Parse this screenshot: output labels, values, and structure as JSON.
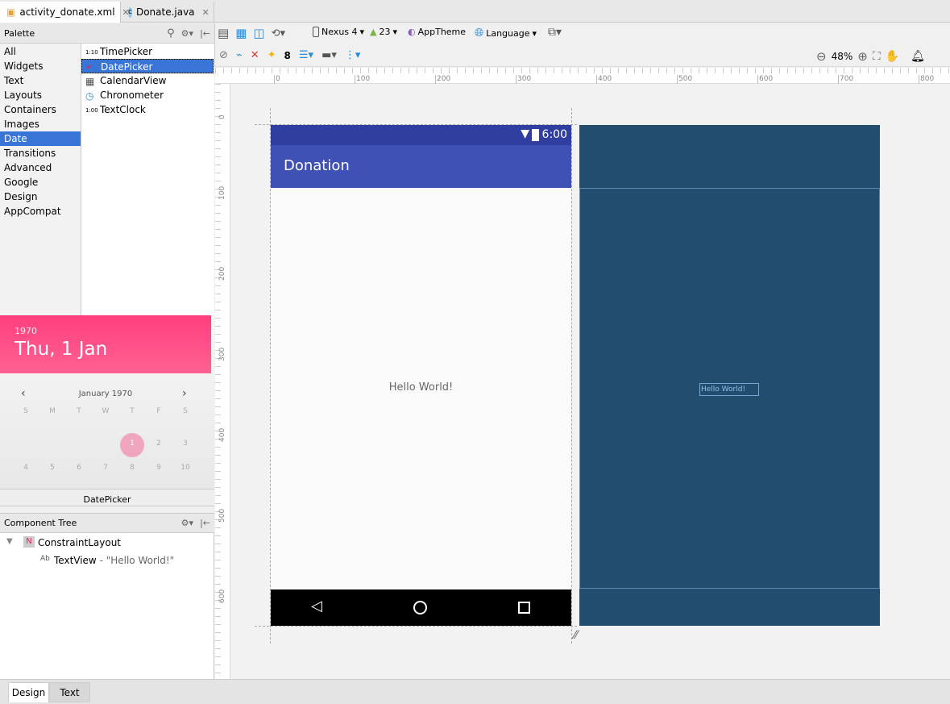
{
  "tabs": [
    {
      "label": "activity_donate.xml",
      "icon": "xml-file-icon",
      "active": true
    },
    {
      "label": "Donate.java",
      "icon": "java-class-icon",
      "active": false
    }
  ],
  "palette": {
    "title": "Palette",
    "categories": [
      "All",
      "Widgets",
      "Text",
      "Layouts",
      "Containers",
      "Images",
      "Date",
      "Transitions",
      "Advanced",
      "Google",
      "Design",
      "AppCompat"
    ],
    "selected_category": "Date",
    "items": [
      {
        "label": "TimePicker",
        "icon": "1:10"
      },
      {
        "label": "DatePicker",
        "icon": "calendar-check"
      },
      {
        "label": "CalendarView",
        "icon": "calendar"
      },
      {
        "label": "Chronometer",
        "icon": "stopwatch"
      },
      {
        "label": "TextClock",
        "icon": "1:00"
      }
    ],
    "selected_item": "DatePicker"
  },
  "preview": {
    "year": "1970",
    "date": "Thu, 1 Jan",
    "month": "January 1970",
    "weekdays": [
      "S",
      "M",
      "T",
      "W",
      "T",
      "F",
      "S"
    ],
    "week1": [
      "",
      "",
      "",
      "",
      "1",
      "2",
      "3"
    ],
    "week2": [
      "4",
      "5",
      "6",
      "7",
      "8",
      "9",
      "10"
    ],
    "caption": "DatePicker",
    "accent": "#ff4081"
  },
  "component_tree": {
    "title": "Component Tree",
    "root": "ConstraintLayout",
    "child_prefix": "Ab",
    "child": "TextView",
    "child_text": " - \"Hello World!\""
  },
  "toolbar": {
    "device": "Nexus 4",
    "api": "23",
    "theme": "AppTheme",
    "language": "Language",
    "margin": "8",
    "zoom": "48%"
  },
  "ruler": {
    "h": [
      "0",
      "100",
      "200",
      "300",
      "400",
      "500",
      "600",
      "700",
      "800"
    ],
    "v": [
      "0",
      "100",
      "200",
      "300",
      "400",
      "500",
      "600"
    ]
  },
  "phone": {
    "time": "6:00",
    "app_title": "Donation",
    "hello": "Hello World!",
    "primary": "#3f51b5",
    "primary_dark": "#303f9f"
  },
  "blueprint": {
    "hello": "Hello World!",
    "color": "#224d6e"
  },
  "bottom_tabs": [
    "Design",
    "Text"
  ]
}
